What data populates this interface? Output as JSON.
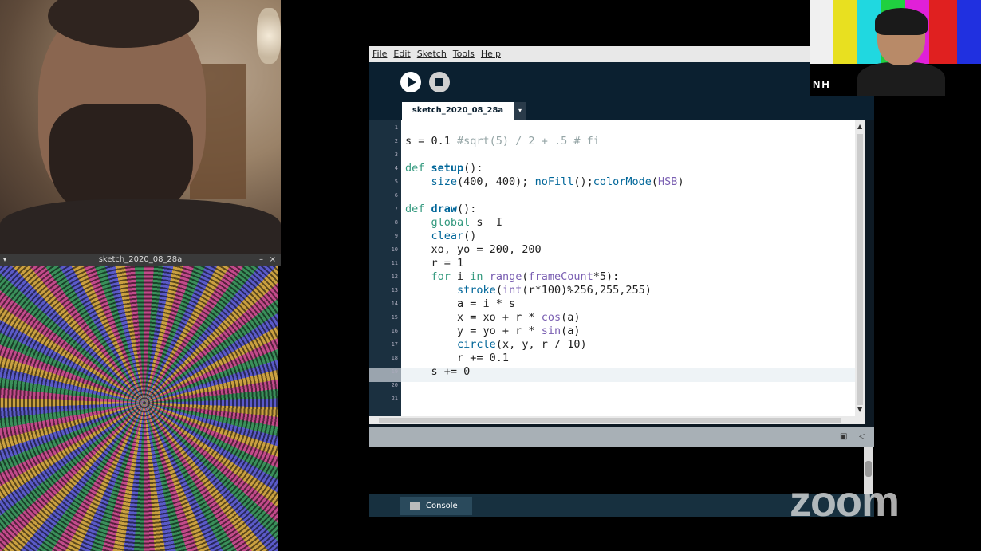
{
  "sketch_window": {
    "title": "sketch_2020_08_28a",
    "minimize": "–",
    "close": "×",
    "menu": "▾"
  },
  "ide": {
    "menu": [
      "File",
      "Edit",
      "Sketch",
      "Tools",
      "Help"
    ],
    "tab_label": "sketch_2020_08_28a",
    "tab_menu": "▾",
    "line_numbers": [
      "1",
      "2",
      "3",
      "4",
      "5",
      "6",
      "7",
      "8",
      "9",
      "10",
      "11",
      "12",
      "13",
      "14",
      "15",
      "16",
      "17",
      "18",
      "19",
      "20",
      "21"
    ],
    "console_label": "Console"
  },
  "participant_initials": "NH",
  "logo_text": "zoom",
  "colors": {
    "ide_dark": "#0b2030",
    "keyword": "#33997e",
    "function": "#006699"
  }
}
